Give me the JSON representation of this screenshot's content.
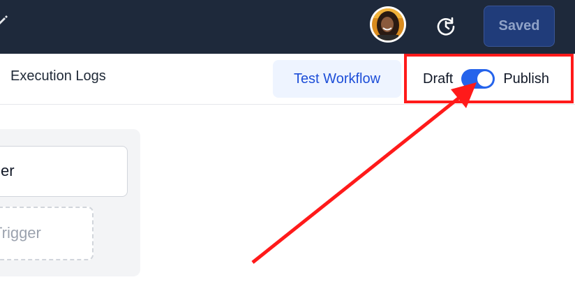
{
  "header": {
    "saved_label": "Saved",
    "avatar_icon": "user-avatar",
    "history_icon": "history-icon",
    "edit_icon": "pencil-icon"
  },
  "toolbar": {
    "tab_label": "Execution Logs",
    "test_button_label": "Test Workflow",
    "draft_label": "Draft",
    "publish_label": "Publish",
    "publish_toggle_on": true
  },
  "canvas": {
    "trigger_card_text": "er",
    "add_trigger_text": "Trigger"
  },
  "annotation": {
    "highlight_color": "#ff1a1a",
    "arrow_color": "#ff1a1a"
  }
}
